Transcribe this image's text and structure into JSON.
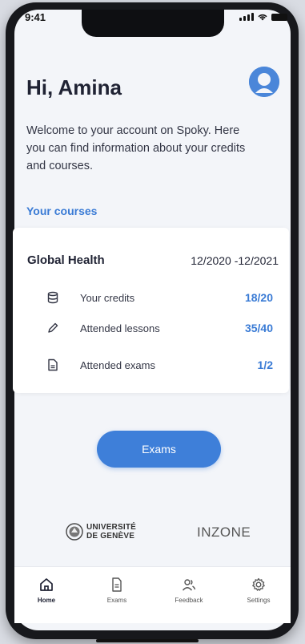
{
  "status_bar": {
    "time": "9:41"
  },
  "header": {
    "greeting": "Hi, Amina",
    "intro": "Welcome to your account on Spoky. Here you can find information about your credits and courses."
  },
  "courses": {
    "section_label": "Your courses",
    "course": {
      "title": "Global Health",
      "dates": "12/2020 -12/2021",
      "rows": [
        {
          "icon": "database-icon",
          "label": "Your credits",
          "value": "18/20"
        },
        {
          "icon": "pencil-icon",
          "label": "Attended lessons",
          "value": "35/40"
        },
        {
          "icon": "document-icon",
          "label": "Attended exams",
          "value": "1/2"
        }
      ]
    }
  },
  "actions": {
    "exams_label": "Exams"
  },
  "partners": {
    "unige_line1": "UNIVERSITÉ",
    "unige_line2": "DE GENÈVE",
    "inzone_label": "INZONE"
  },
  "tabbar": {
    "tabs": [
      {
        "label": "Home",
        "icon": "home-icon",
        "active": true
      },
      {
        "label": "Exams",
        "icon": "document-icon",
        "active": false
      },
      {
        "label": "Feedback",
        "icon": "users-icon",
        "active": false
      },
      {
        "label": "Settings",
        "icon": "gear-icon",
        "active": false
      }
    ]
  },
  "colors": {
    "accent": "#3e7fd9",
    "background": "#f3f5f9"
  }
}
